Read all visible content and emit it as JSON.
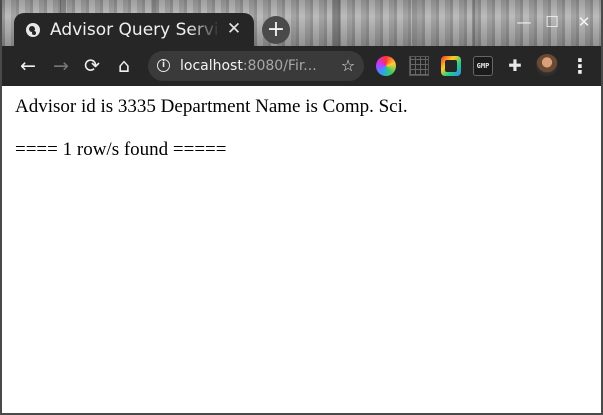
{
  "tab": {
    "title": "Advisor Query Service",
    "close_glyph": "✕"
  },
  "new_tab_glyph": "+",
  "window_controls": {
    "minimize": "—",
    "maximize": "☐",
    "close": "✕"
  },
  "nav": {
    "back": "←",
    "forward": "→",
    "reload": "⟳",
    "home": "⌂"
  },
  "omnibox": {
    "info_glyph": "i",
    "url_host": "localhost",
    "url_rest": ":8080/Fir...",
    "star_glyph": "☆"
  },
  "extensions": {
    "gmp_label": "GMP",
    "puzzle_glyph": "✚",
    "menu_glyph": "⋮"
  },
  "content": {
    "line1": "Advisor id is 3335 Department Name is Comp. Sci.",
    "line2": "==== 1 row/s found ====="
  }
}
